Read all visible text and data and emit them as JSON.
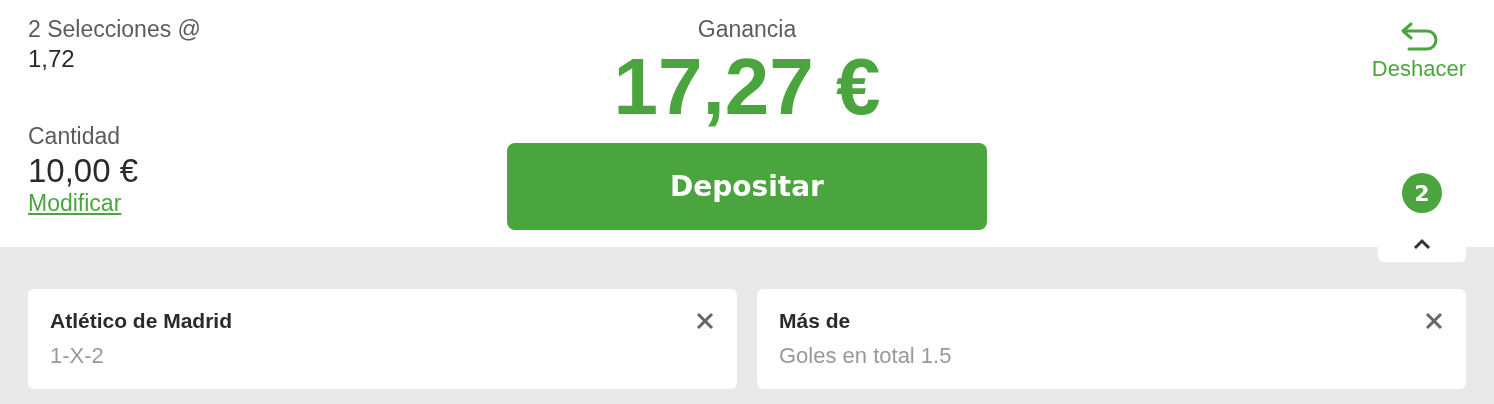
{
  "summary": {
    "selections_label": "2 Selecciones @",
    "odds": "1,72",
    "stake_label": "Cantidad",
    "stake": "10,00 €",
    "modify_link": "Modificar"
  },
  "payout": {
    "label": "Ganancia",
    "amount": "17,27 €",
    "button": "Depositar"
  },
  "undo": {
    "label": "Deshacer"
  },
  "toggle": {
    "count": "2",
    "expanded": false
  },
  "selections": [
    {
      "title": "Atlético de Madrid",
      "market": "1-X-2"
    },
    {
      "title": "Más de",
      "market": "Goles en total 1.5"
    }
  ]
}
